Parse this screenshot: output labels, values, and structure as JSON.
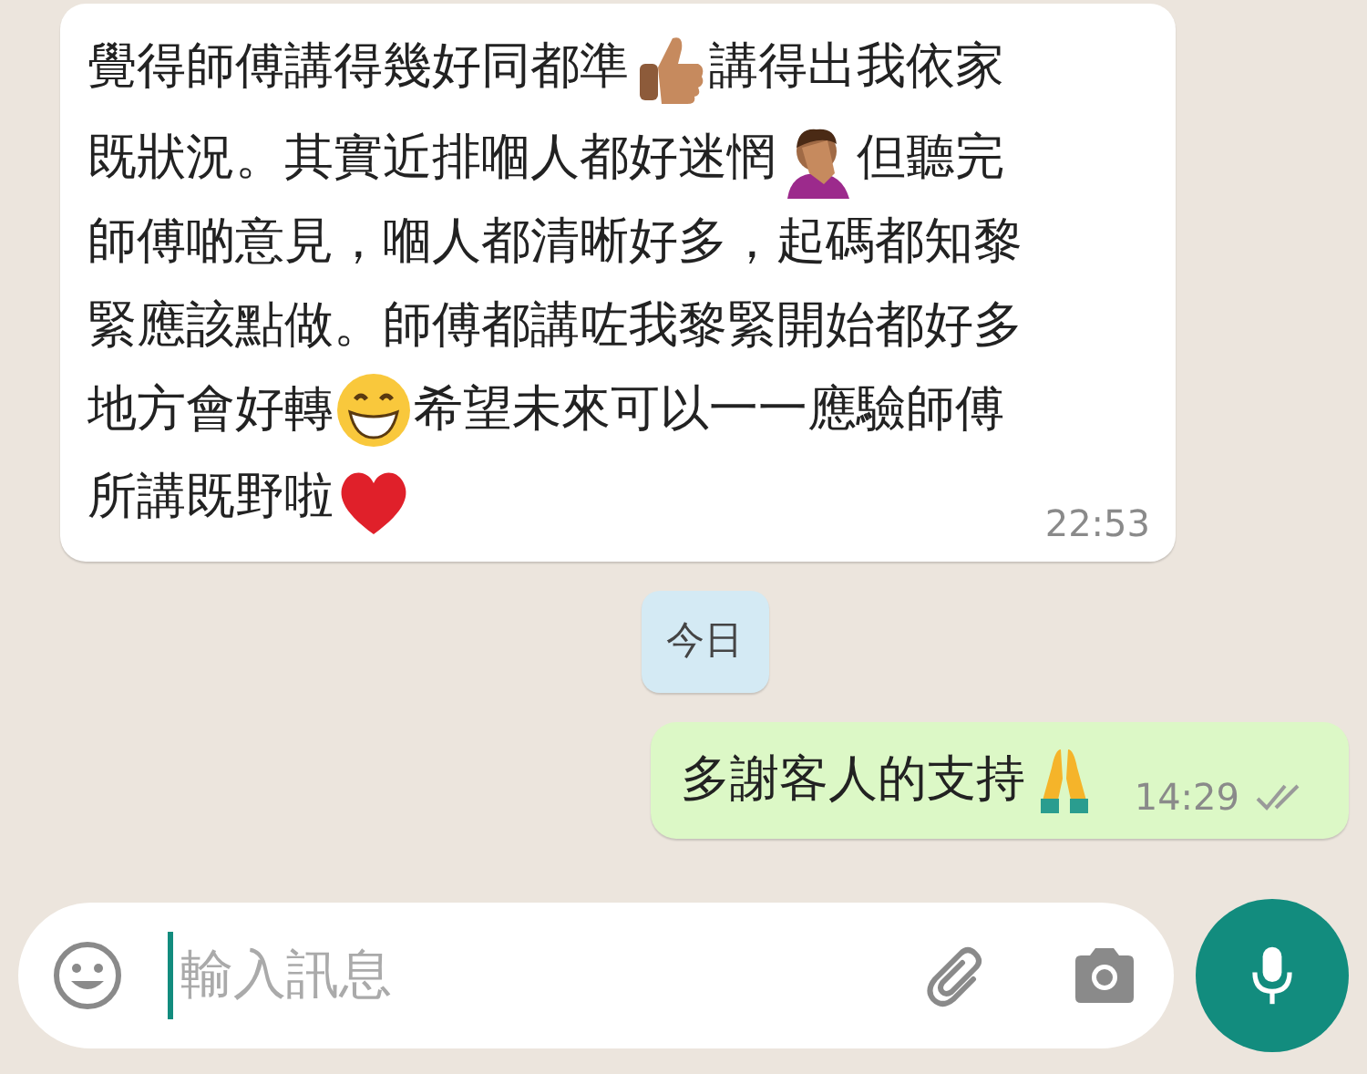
{
  "messages": [
    {
      "kind": "incoming",
      "time": "22:53",
      "lines": [
        [
          {
            "kind": "text",
            "text": "覺得師傅講得幾好同都準"
          },
          {
            "kind": "thumbsup"
          },
          {
            "kind": "text",
            "text": "講得出我依家"
          }
        ],
        [
          {
            "kind": "text",
            "text": "既狀況。其實近排嗰人都好迷惘"
          },
          {
            "kind": "facepalm"
          },
          {
            "kind": "text",
            "text": "但聽完"
          }
        ],
        [
          {
            "kind": "text",
            "text": "師傅啲意見，嗰人都清晰好多，起碼都知黎"
          }
        ],
        [
          {
            "kind": "text",
            "text": "緊應該點做。師傅都講咗我黎緊開始都好多"
          }
        ],
        [
          {
            "kind": "text",
            "text": "地方會好轉"
          },
          {
            "kind": "grin"
          },
          {
            "kind": "text",
            "text": "希望未來可以一一應驗師傅"
          }
        ],
        [
          {
            "kind": "text",
            "text": "所講既野啦"
          },
          {
            "kind": "heart"
          }
        ]
      ]
    },
    {
      "kind": "date",
      "text": "今日"
    },
    {
      "kind": "outgoing",
      "time": "14:29",
      "read": false,
      "lines": [
        [
          {
            "kind": "text",
            "text": "多謝客人的支持"
          },
          {
            "kind": "pray"
          }
        ]
      ]
    }
  ],
  "composer": {
    "placeholder": "輸入訊息"
  }
}
